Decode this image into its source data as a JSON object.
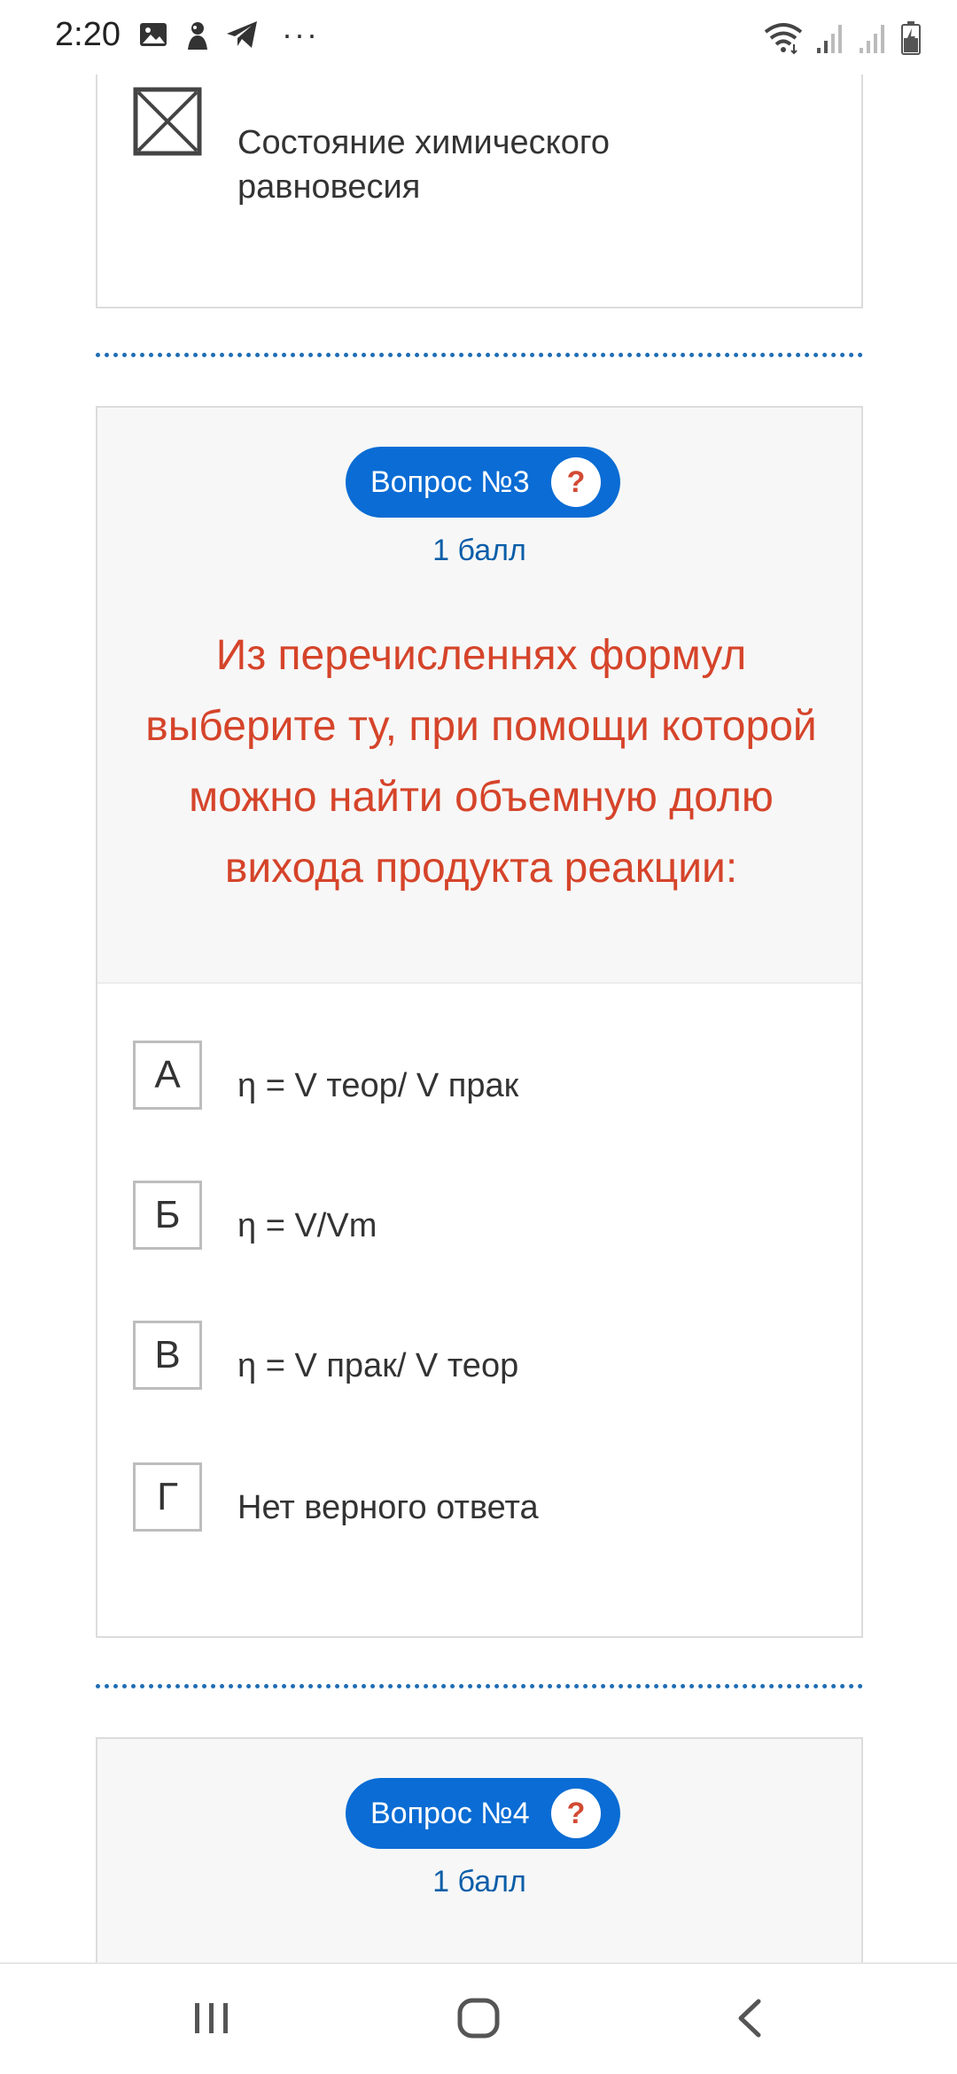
{
  "status_bar": {
    "time": "2:20",
    "left_icons": [
      "image-icon",
      "app-notification-icon",
      "telegram-icon",
      "more-icon"
    ],
    "more_glyph": "···",
    "right_icons": [
      "wifi-icon",
      "signal-1-icon",
      "signal-2-icon",
      "battery-charging-icon"
    ]
  },
  "previous_answer": {
    "text": "Состояние химического равновесия",
    "checkbox_state": "crossed"
  },
  "question_3": {
    "badge": "Вопрос №3",
    "help": "?",
    "points": "1 балл",
    "text": "Из перечисленнях формул выберите ту, при помощи которой можно найти объемную долю вихода продукта реакции:",
    "options": [
      {
        "letter": "А",
        "text": "η = V теор/ V прак"
      },
      {
        "letter": "Б",
        "text": "η = V/Vm"
      },
      {
        "letter": "В",
        "text": "η = V прак/ V теор"
      },
      {
        "letter": "Г",
        "text": "Нет верного ответа"
      }
    ]
  },
  "question_4": {
    "badge": "Вопрос №4",
    "help": "?",
    "points": "1 балл"
  },
  "nav_bar": {
    "buttons": [
      "recent-apps-icon",
      "home-icon",
      "back-icon"
    ]
  },
  "colors": {
    "accent": "#0a6cd4",
    "question_text": "#d5442a",
    "points_text": "#0a5ea8",
    "divider": "#1f6db5"
  }
}
